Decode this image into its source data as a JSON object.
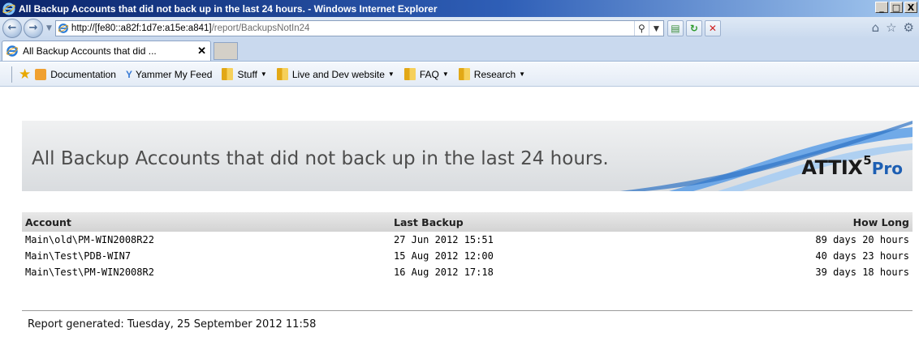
{
  "window": {
    "title": "All Backup Accounts that did not back up in the last 24 hours. - Windows Internet Explorer",
    "controls": {
      "minimize": "_",
      "maximize": "□",
      "close": "X"
    }
  },
  "address_bar": {
    "url_prefix": "http://",
    "url_host": "[fe80::a82f:1d7e:a15e:a841]",
    "url_path": "/report/BackupsNotIn24"
  },
  "tab": {
    "label": "All Backup Accounts that did ...",
    "close": "✕"
  },
  "favorites_bar": {
    "items": [
      {
        "label": "Documentation",
        "icon": "documentation-icon"
      },
      {
        "label": "Yammer  My Feed",
        "icon": "yammer-icon"
      },
      {
        "label": "Stuff",
        "icon": "folder-icon",
        "dropdown": true
      },
      {
        "label": "Live and Dev website",
        "icon": "folder-icon",
        "dropdown": true
      },
      {
        "label": "FAQ",
        "icon": "folder-icon",
        "dropdown": true
      },
      {
        "label": "Research",
        "icon": "folder-icon",
        "dropdown": true
      }
    ]
  },
  "report": {
    "title": "All Backup Accounts that did not back up in the last 24 hours.",
    "logo": {
      "brand": "ATTIX",
      "version": "5",
      "edition": "Pro"
    },
    "columns": {
      "account": "Account",
      "last_backup": "Last Backup",
      "how_long": "How Long"
    },
    "rows": [
      {
        "account": "Main\\old\\PM-WIN2008R22",
        "last_backup": "27 Jun 2012 15:51",
        "how_long": "89 days 20 hours"
      },
      {
        "account": "Main\\Test\\PDB-WIN7",
        "last_backup": "15 Aug 2012 12:00",
        "how_long": "40 days 23 hours"
      },
      {
        "account": "Main\\Test\\PM-WIN2008R2",
        "last_backup": "16 Aug 2012 17:18",
        "how_long": "39 days 18 hours"
      }
    ],
    "footer": "Report generated: Tuesday, 25 September 2012 11:58"
  },
  "colors": {
    "title_bar_start": "#0a246a",
    "title_bar_end": "#a6caf0",
    "logo_pro": "#1d5fb3",
    "banner_swoosh": "#4a8fd8"
  }
}
